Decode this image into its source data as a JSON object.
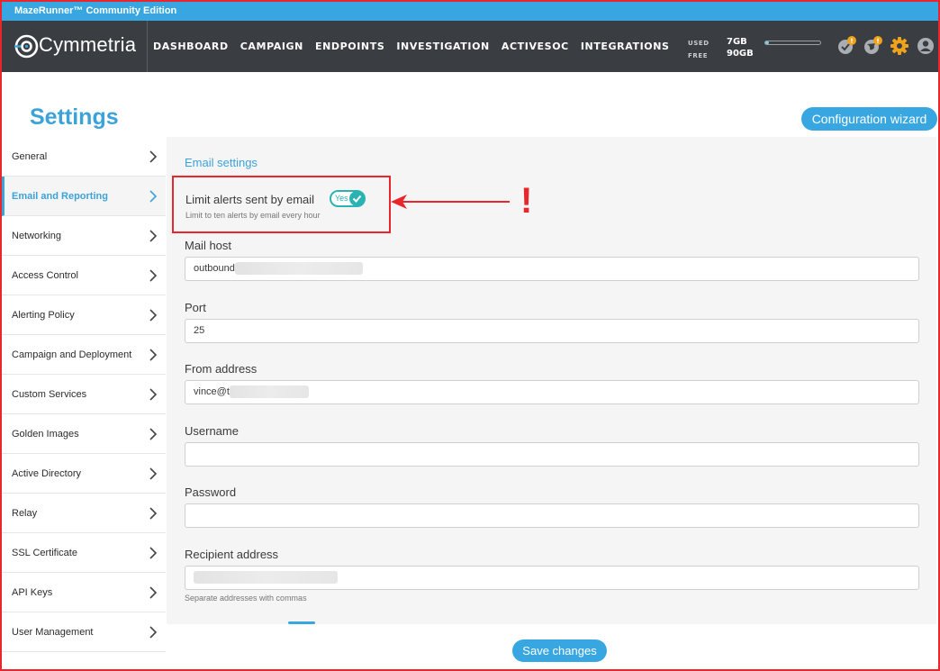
{
  "window": {
    "title": "MazeRunner™ Community Edition"
  },
  "brand": {
    "logo_text": "Cymmetria",
    "logo_icon": "eye-icon"
  },
  "nav": {
    "items": [
      "DASHBOARD",
      "CAMPAIGN",
      "ENDPOINTS",
      "INVESTIGATION",
      "ACTIVESOC",
      "INTEGRATIONS"
    ]
  },
  "storage": {
    "used_label": "USED",
    "used_value": "7GB",
    "free_label": "FREE",
    "free_value": "90GB",
    "used_fraction": 0.07
  },
  "nav_icons": [
    "alerts-badge-icon",
    "globe-badge-icon",
    "gear-icon",
    "user-icon"
  ],
  "page": {
    "title": "Settings",
    "wizard_button": "Configuration wizard",
    "save_button": "Save changes"
  },
  "sidebar": {
    "items": [
      {
        "label": "General",
        "active": false
      },
      {
        "label": "Email and Reporting",
        "active": true
      },
      {
        "label": "Networking",
        "active": false
      },
      {
        "label": "Access Control",
        "active": false
      },
      {
        "label": "Alerting Policy",
        "active": false
      },
      {
        "label": "Campaign and Deployment",
        "active": false
      },
      {
        "label": "Custom Services",
        "active": false
      },
      {
        "label": "Golden Images",
        "active": false
      },
      {
        "label": "Active Directory",
        "active": false
      },
      {
        "label": "Relay",
        "active": false
      },
      {
        "label": "SSL Certificate",
        "active": false
      },
      {
        "label": "API Keys",
        "active": false
      },
      {
        "label": "User Management",
        "active": false
      }
    ]
  },
  "email": {
    "section_title": "Email settings",
    "limit_label": "Limit alerts sent by email",
    "limit_hint": "Limit to ten alerts by email every hour",
    "limit_toggle_label": "Yes",
    "limit_enabled": true,
    "mail_host_label": "Mail host",
    "mail_host_value": "outbound",
    "port_label": "Port",
    "port_value": "25",
    "from_label": "From address",
    "from_value": "vince@t",
    "username_label": "Username",
    "username_value": "",
    "password_label": "Password",
    "password_value": "",
    "recipient_label": "Recipient address",
    "recipient_value": "",
    "recipient_hint": "Separate addresses with commas"
  },
  "annotation": {
    "mark": "!",
    "color": "#e8262b"
  },
  "colors": {
    "accent": "#38a7e1",
    "navbar": "#3a3e43",
    "toggle": "#2bb3b3",
    "annotation": "#e8262b"
  }
}
